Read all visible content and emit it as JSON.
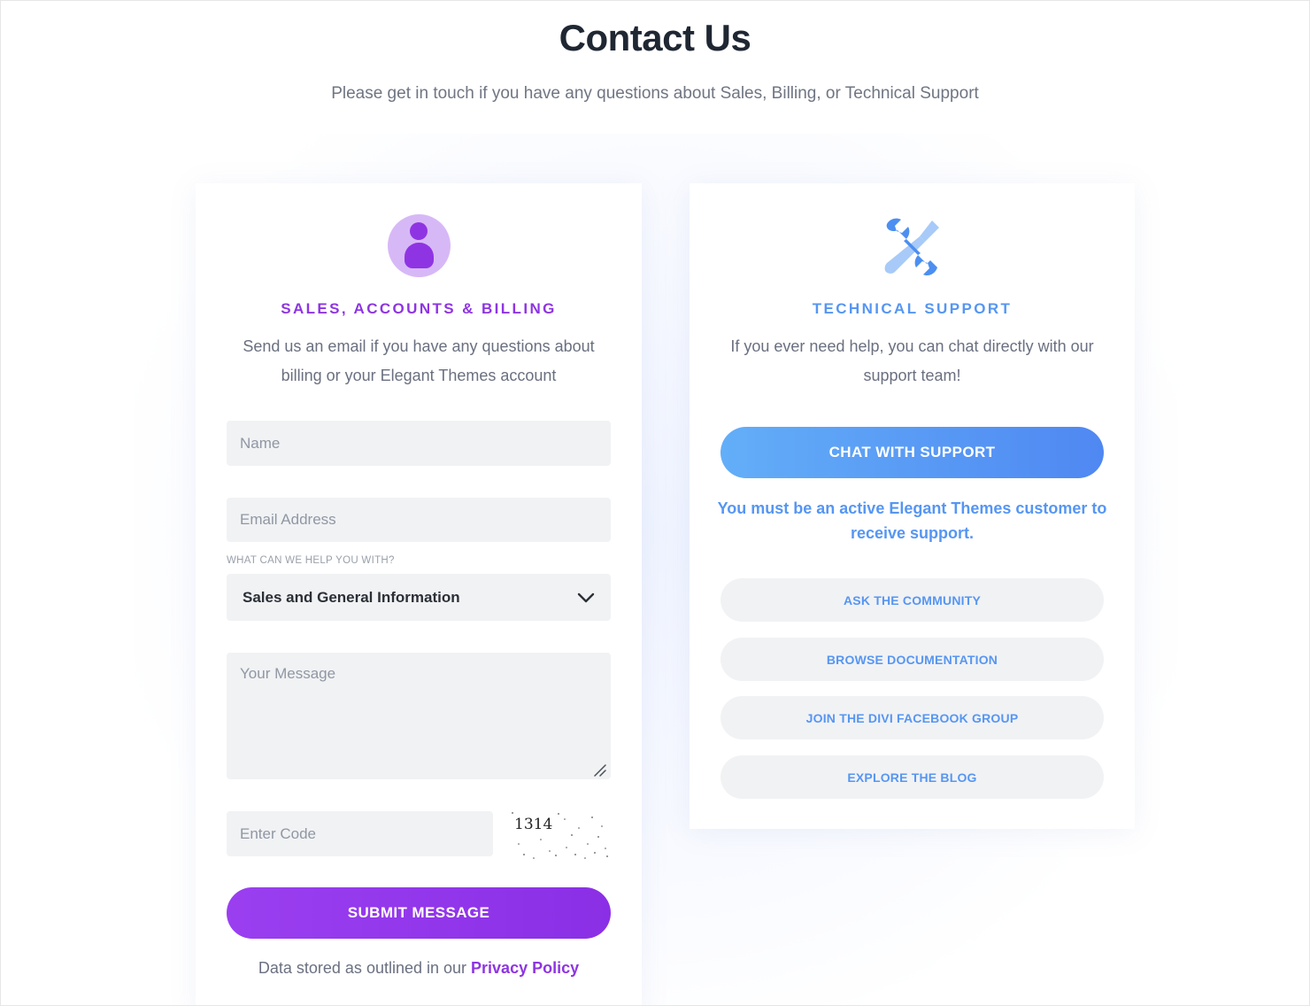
{
  "header": {
    "title": "Contact Us",
    "subtitle": "Please get in touch if you have any questions about Sales, Billing, or Technical Support"
  },
  "sales": {
    "icon": "user-icon",
    "title": "SALES, ACCOUNTS & BILLING",
    "description": "Send us an email if you have any questions about billing or your Elegant Themes account",
    "form": {
      "name_placeholder": "Name",
      "email_placeholder": "Email Address",
      "help_label": "WHAT CAN WE HELP YOU WITH?",
      "help_selected": "Sales and General Information",
      "message_placeholder": "Your Message",
      "code_placeholder": "Enter Code",
      "captcha_code": "1314",
      "submit_label": "SUBMIT MESSAGE"
    },
    "footer_text": "Data stored as outlined in our ",
    "footer_link": "Privacy Policy"
  },
  "support": {
    "icon": "wrench-screwdriver-icon",
    "title": "TECHNICAL SUPPORT",
    "description": "If you ever need help, you can chat directly with our support team!",
    "chat_button": "CHAT WITH SUPPORT",
    "notice": "You must be an active Elegant Themes customer to receive support.",
    "links": [
      "ASK THE COMMUNITY",
      "BROWSE DOCUMENTATION",
      "JOIN THE DIVI FACEBOOK GROUP",
      "EXPLORE THE BLOG"
    ]
  },
  "colors": {
    "purple": "#8e35e2",
    "blue": "#5696f2",
    "title": "#1f2733",
    "field_bg": "#f1f2f4"
  }
}
